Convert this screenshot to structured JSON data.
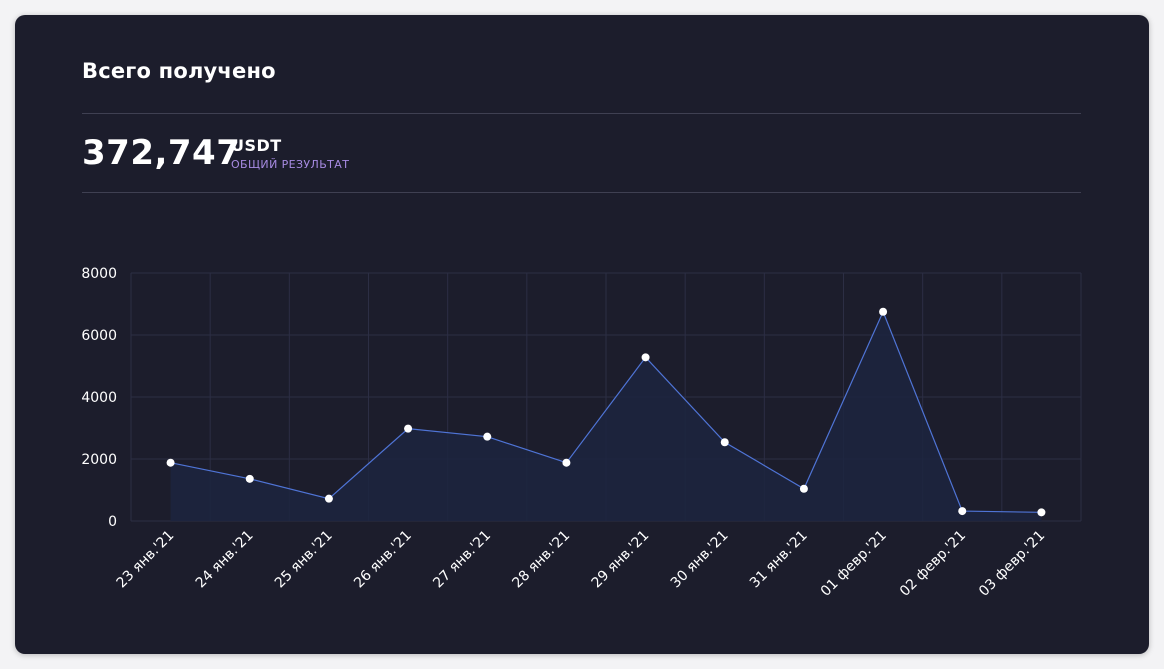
{
  "card": {
    "title": "Всего получено",
    "total": "372,747",
    "currency": "USDT",
    "subtitle": "ОБЩИЙ РЕЗУЛЬТАТ"
  },
  "colors": {
    "background": "#1c1d2c",
    "line": "#4f74d6",
    "area": "#1c2440",
    "grid": "#2c2e44",
    "point": "#ffffff",
    "subtitle": "#a78be2"
  },
  "chart_data": {
    "type": "area",
    "categories": [
      "23 янв.'21",
      "24 янв.'21",
      "25 янв.'21",
      "26 янв.'21",
      "27 янв.'21",
      "28 янв.'21",
      "29 янв.'21",
      "30 янв.'21",
      "31 янв.'21",
      "01 февр.'21",
      "02 февр.'21",
      "03 февр.'21"
    ],
    "values": [
      1880,
      1360,
      720,
      2980,
      2720,
      1880,
      5280,
      2540,
      1040,
      6750,
      320,
      280
    ],
    "ylim": [
      0,
      8000
    ],
    "yticks": [
      "0",
      "2000",
      "4000",
      "6000",
      "8000"
    ],
    "grid": true
  }
}
